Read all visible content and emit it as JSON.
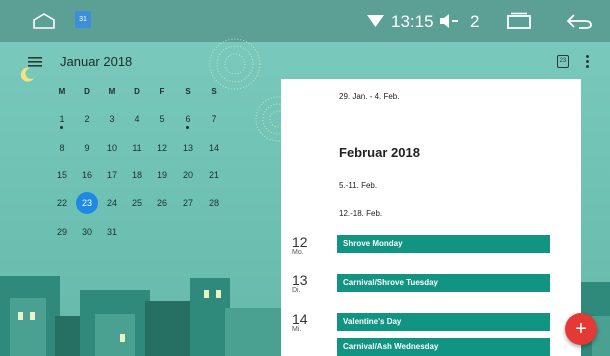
{
  "status_bar": {
    "calendar_icon_date": "31",
    "time": "13:15",
    "notification_count": "2"
  },
  "header": {
    "month_title": "Januar 2018",
    "today_icon_date": "23"
  },
  "mini_calendar": {
    "weekday_headers": [
      "M",
      "D",
      "M",
      "D",
      "F",
      "S",
      "S"
    ],
    "weeks": [
      [
        "1",
        "2",
        "3",
        "4",
        "5",
        "6",
        "7"
      ],
      [
        "8",
        "9",
        "10",
        "11",
        "12",
        "13",
        "14"
      ],
      [
        "15",
        "16",
        "17",
        "18",
        "19",
        "20",
        "21"
      ],
      [
        "22",
        "23",
        "24",
        "25",
        "26",
        "27",
        "28"
      ],
      [
        "29",
        "30",
        "31",
        "",
        "",
        "",
        ""
      ]
    ],
    "selected_day": "23"
  },
  "schedule": {
    "week_29": "29. Jan. - 4. Feb.",
    "month_heading": "Februar 2018",
    "week_5": "5.-11. Feb.",
    "week_12": "12.-18. Feb.",
    "days": [
      {
        "num": "12",
        "dow": "Mo.",
        "events": [
          "Shrove Monday"
        ]
      },
      {
        "num": "13",
        "dow": "Di.",
        "events": [
          "Carnival/Shrove Tuesday"
        ]
      },
      {
        "num": "14",
        "dow": "Mi.",
        "events": [
          "Valentine's Day",
          "Carnival/Ash Wednesday"
        ]
      }
    ]
  },
  "fab": {
    "label": "+"
  },
  "colors": {
    "accent": "#129482",
    "fab": "#e53935",
    "today": "#1e88e5"
  }
}
